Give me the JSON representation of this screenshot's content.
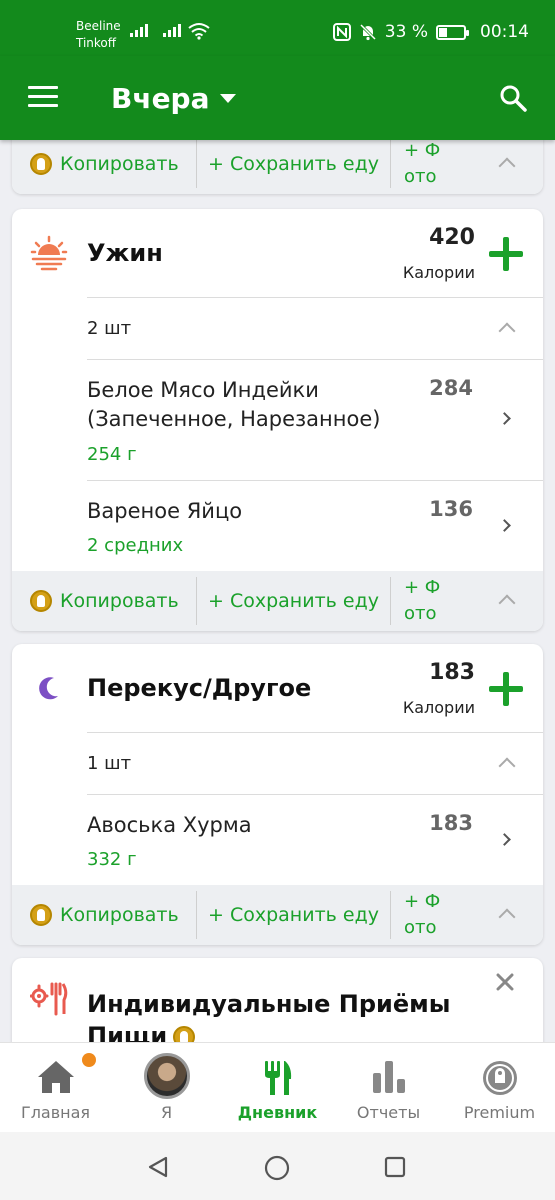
{
  "status_bar": {
    "carrier_1": "Beeline",
    "carrier_2": "Tinkoff",
    "battery": "33 %",
    "time": "00:14"
  },
  "app_bar": {
    "title": "Вчера"
  },
  "actions": {
    "copy": "Копировать",
    "save": "+ Сохранить еду",
    "photo_line1": "+ Ф",
    "photo_line2": "ото"
  },
  "dinner": {
    "title": "Ужин",
    "calories": "420",
    "calories_label": "Калории",
    "count": "2 шт",
    "items": [
      {
        "name_line1": "Белое Мясо Индейки",
        "name_line2": "(Запеченное, Нарезанное)",
        "amount": "254 г",
        "calories": "284"
      },
      {
        "name_line1": "Вареное Яйцо",
        "amount": "2 средних",
        "calories": "136"
      }
    ]
  },
  "snack": {
    "title": "Перекус/Другое",
    "calories": "183",
    "calories_label": "Калории",
    "count": "1 шт",
    "items": [
      {
        "name_line1": "Авоська Хурма",
        "amount": "332 г",
        "calories": "183"
      }
    ]
  },
  "custom_meals": {
    "title_line1": "Индивидуальные Приёмы",
    "title_line2": "Пищи"
  },
  "bottom_nav": {
    "home": "Главная",
    "me": "Я",
    "diary": "Дневник",
    "reports": "Отчеты",
    "premium": "Premium"
  },
  "colors": {
    "brand_green": "#138a1c",
    "accent_green": "#1ba12b",
    "notification": "#ef8a1c",
    "dinner_icon": "#f07b52",
    "snack_icon": "#7c4fc4"
  }
}
